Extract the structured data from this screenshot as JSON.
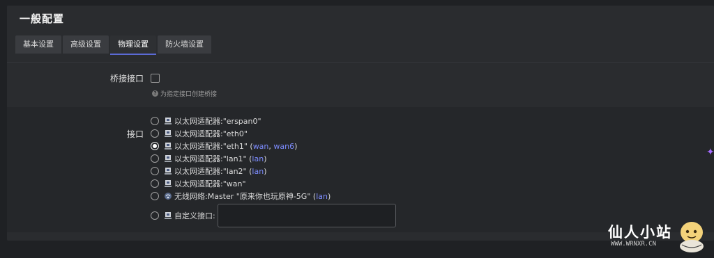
{
  "panel": {
    "title": "一般配置"
  },
  "tabs": [
    {
      "label": "基本设置"
    },
    {
      "label": "高级设置"
    },
    {
      "label": "物理设置"
    },
    {
      "label": "防火墙设置"
    }
  ],
  "active_tab": "物理设置",
  "bridge": {
    "label": "桥接接口",
    "checked": false,
    "hint": "为指定接口创建桥接"
  },
  "interface": {
    "label": "接口",
    "options": [
      {
        "prefix": "以太网适配器: ",
        "name": "\"erspan0\"",
        "tags": [],
        "checked": false
      },
      {
        "prefix": "以太网适配器: ",
        "name": "\"eth0\"",
        "tags": [],
        "checked": false
      },
      {
        "prefix": "以太网适配器: ",
        "name": "\"eth1\"",
        "tags": [
          "wan",
          "wan6"
        ],
        "checked": true
      },
      {
        "prefix": "以太网适配器: ",
        "name": "\"lan1\"",
        "tags": [
          "lan"
        ],
        "checked": false
      },
      {
        "prefix": "以太网适配器: ",
        "name": "\"lan2\"",
        "tags": [
          "lan"
        ],
        "checked": false
      },
      {
        "prefix": "以太网适配器: ",
        "name": "\"wan\"",
        "tags": [],
        "checked": false
      },
      {
        "prefix": "无线网络: ",
        "name": "Master \"原来你也玩原神-5G\"",
        "tags": [
          "lan"
        ],
        "checked": false
      }
    ],
    "custom_label": "自定义接口:",
    "custom_value": ""
  },
  "colors": {
    "accent": "#5b6ad6",
    "tag": "#7d8cff"
  },
  "watermark": {
    "title": "仙人小站",
    "url": "WWW.WRNXR.CN"
  }
}
